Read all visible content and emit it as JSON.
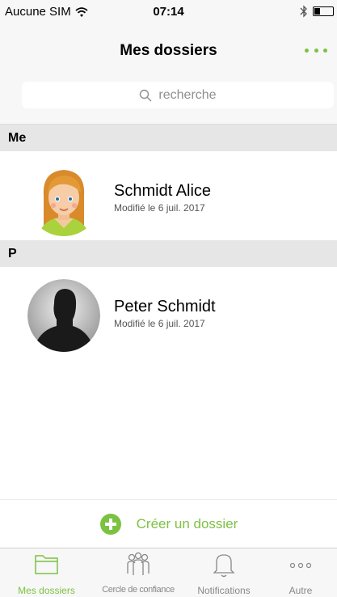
{
  "status_bar": {
    "carrier": "Aucune SIM",
    "time": "07:14"
  },
  "nav": {
    "title": "Mes dossiers"
  },
  "search": {
    "placeholder": "recherche"
  },
  "sections": [
    {
      "header": "Me",
      "contact": {
        "name": "Schmidt Alice",
        "modified": "Modifié le 6 juil. 2017"
      }
    },
    {
      "header": "P",
      "contact": {
        "name": "Peter Schmidt",
        "modified": "Modifié le 6 juil. 2017"
      }
    }
  ],
  "create_label": "Créer un dossier",
  "tabs": [
    {
      "label": "Mes dossiers",
      "icon": "folder-icon",
      "active": true
    },
    {
      "label": "Cercle de confiance",
      "icon": "people-icon",
      "active": false
    },
    {
      "label": "Notifications",
      "icon": "bell-icon",
      "active": false
    },
    {
      "label": "Autre",
      "icon": "ellipsis-icon",
      "active": false
    }
  ],
  "colors": {
    "accent": "#7cc242",
    "section_bg": "#e6e6e6",
    "bar_bg": "#f7f7f7"
  }
}
